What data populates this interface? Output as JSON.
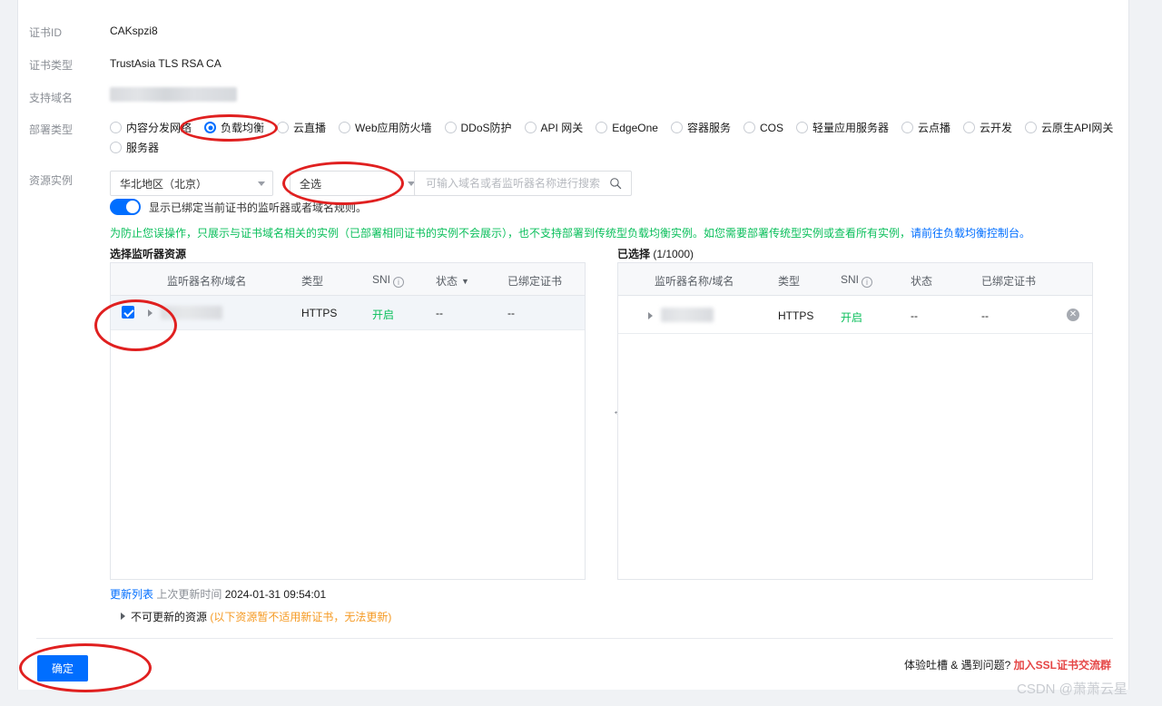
{
  "form": {
    "rows": [
      {
        "label": "证书ID",
        "value": "CAKspzi8"
      },
      {
        "label": "证书类型",
        "value": "TrustAsia TLS RSA CA"
      },
      {
        "label": "支持域名",
        "value": ""
      },
      {
        "label": "部署类型",
        "value": ""
      },
      {
        "label": "资源实例",
        "value": ""
      }
    ]
  },
  "deploy_type": {
    "label": "部署类型",
    "selected": "负载均衡",
    "options_row1": [
      "内容分发网络",
      "负载均衡",
      "云直播",
      "Web应用防火墙",
      "DDoS防护",
      "API 网关",
      "EdgeOne",
      "容器服务",
      "COS",
      "轻量应用服务器",
      "云点播",
      "云开发",
      "云原生API网关"
    ],
    "options_row2": [
      "服务器"
    ]
  },
  "resource": {
    "label": "资源实例",
    "region_select": "华北地区（北京）",
    "scope_select": "全选",
    "search_placeholder": "可输入域名或者监听器名称进行搜索",
    "search_value": "",
    "search_icon": "search-icon",
    "toggle_on": true,
    "toggle_label": "显示已绑定当前证书的监听器或者域名规则。",
    "notice": "为防止您误操作，只展示与证书域名相关的实例（已部署相同证书的实例不会展示），也不支持部署到传统型负载均衡实例。如您需要部署传统型实例或查看所有实例，",
    "notice_link": "请前往负载均衡控制台。"
  },
  "transfer": {
    "left_title": "选择监听器资源",
    "right_title": "已选择",
    "right_count": "(1/1000)",
    "columns": [
      "监听器名称/域名",
      "类型",
      "SNI",
      "状态",
      "已绑定证书"
    ],
    "sni_info_icon": "info-icon",
    "status_filter_icon": "filter-icon",
    "middle_icon": "transfer-arrow-icon",
    "left_rows": [
      {
        "checked": true,
        "name": "",
        "type": "HTTPS",
        "sni": "开启",
        "status": "--",
        "bound_cert": "--"
      }
    ],
    "right_rows": [
      {
        "name": "",
        "type": "HTTPS",
        "sni": "开启",
        "status": "--",
        "bound_cert": "--",
        "remove_icon": "remove-icon"
      }
    ]
  },
  "update": {
    "refresh_link": "更新列表",
    "last_update_label": "上次更新时间",
    "last_update_value": "2024-01-31 09:54:01",
    "unavailable_title": "不可更新的资源",
    "unavailable_note": "(以下资源暂不适用新证书，无法更新)"
  },
  "footer": {
    "confirm_label": "确定",
    "feedback_text": "体验吐槽 & 遇到问题?",
    "feedback_link": "加入SSL证书交流群",
    "watermark": "CSDN @萧萧云星"
  },
  "colors": {
    "accent": "#006eff",
    "success": "#0abf5b",
    "warning": "#f59a23",
    "danger": "#e54545",
    "annotation": "#e02020"
  }
}
